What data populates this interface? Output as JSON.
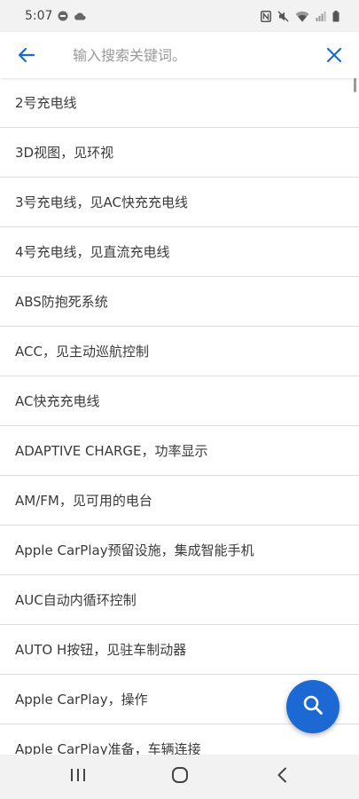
{
  "status_bar": {
    "time": "5:07",
    "icons": [
      "notification-badge-icon",
      "cloud-icon",
      "nfc-icon",
      "mute-icon",
      "wifi-icon",
      "signal-icon",
      "battery-icon"
    ]
  },
  "header": {
    "back_icon": "arrow-left-icon",
    "search_placeholder": "输入搜索关键词。",
    "search_value": "",
    "close_icon": "close-icon"
  },
  "colors": {
    "accent": "#1c69d4",
    "divider": "#dcdcdc",
    "text": "#3a3a3a",
    "placeholder": "#9a9a9a"
  },
  "list": {
    "items": [
      "2号充电线",
      "3D视图，见环视",
      "3号充电线，见AC快充充电线",
      "4号充电线，见直流充电线",
      "ABS防抱死系统",
      "ACC，见主动巡航控制",
      "AC快充充电线",
      "ADAPTIVE CHARGE，功率显示",
      "AM/FM，见可用的电台",
      "Apple CarPlay预留设施，集成智能手机",
      "AUC自动内循环控制",
      "AUTO H按钮，见驻车制动器",
      "Apple CarPlay，操作",
      "Apple CarPlay准备，车辆连接"
    ]
  },
  "fab": {
    "icon": "search-icon"
  },
  "nav_bar": {
    "recent_icon": "recent-apps-icon",
    "home_icon": "home-icon",
    "back_icon": "back-chevron-icon"
  }
}
